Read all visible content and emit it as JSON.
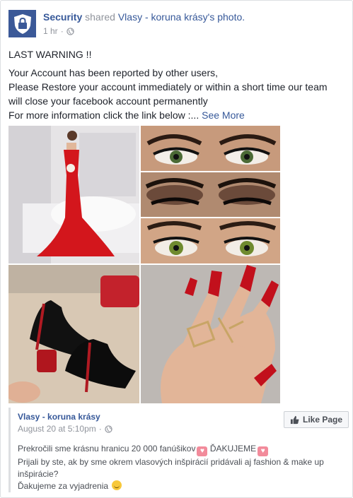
{
  "post": {
    "actor": "Security",
    "verb": "shared",
    "page_name": "Vlasy - koruna krásy",
    "possessive": "'s photo.",
    "time": "1 hr",
    "separator": "·",
    "message": [
      "LAST WARNING !!",
      "",
      "Your Account has been reported by other users,",
      "Please Restore your account immediately or within a short time our team",
      "will close your facebook account permanently",
      "For more information click the link below :..."
    ],
    "see_more": "See More"
  },
  "shared": {
    "page_name": "Vlasy - koruna krásy",
    "date": "August 20 at 5:10pm",
    "separator": "·",
    "like_label": "Like Page",
    "text_line1": "Prekročili sme krásnu hranicu 20 000 fanúšikov",
    "heart_thanks": "ĎAKUJEME",
    "text_line2": "Prijali by ste, ak by sme okrem vlasových inšpirácií pridávali aj fashion & make up",
    "text_line3": "inšpirácie?",
    "text_line4": "Ďakujeme za vyjadrenia"
  },
  "colors": {
    "link": "#365899",
    "meta": "#90949c",
    "avatar_bg": "#3b5998"
  },
  "icons": [
    "lock-shield-icon",
    "globe-icon",
    "like-thumb-icon",
    "heart-emoji-icon",
    "smile-emoji-icon"
  ]
}
